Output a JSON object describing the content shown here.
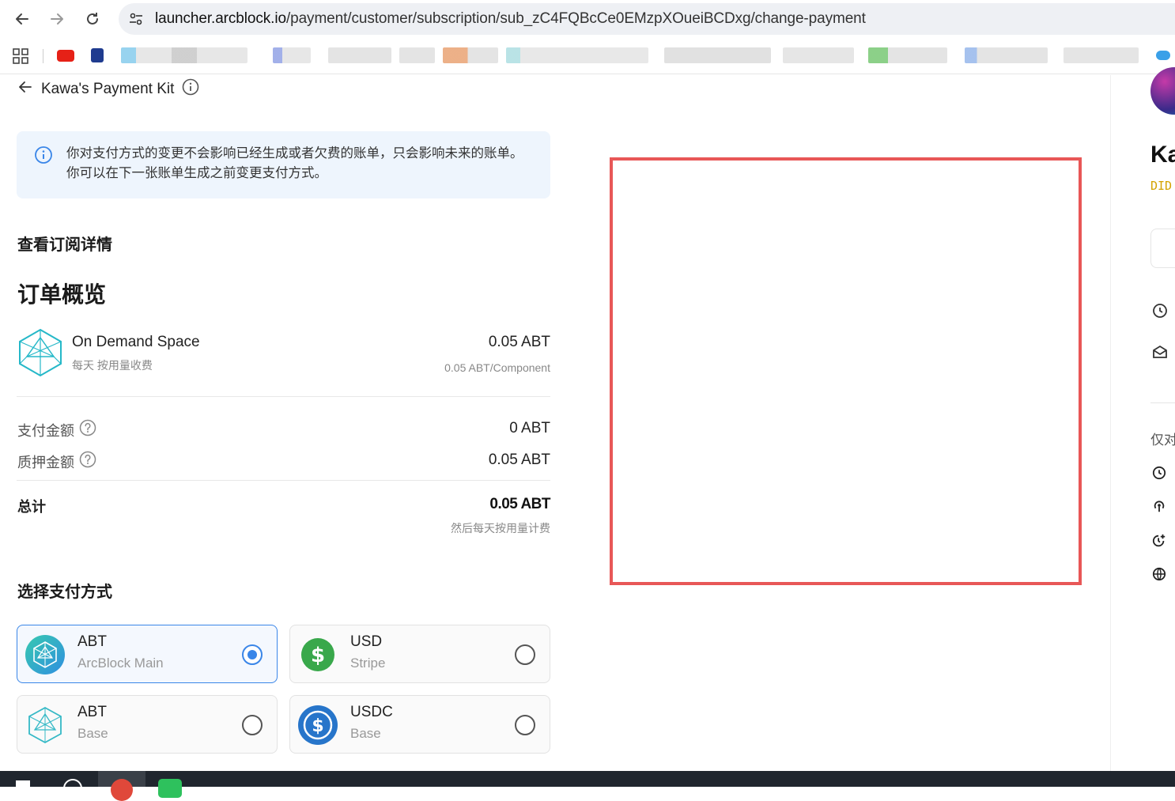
{
  "browser": {
    "url_host": "launcher.arcblock.io",
    "url_path": "/payment/customer/subscription/sub_zC4FQBcCe0EMzpXOueiBCDxg/change-payment"
  },
  "page": {
    "back_label": "Kawa's Payment Kit",
    "alert_text": "你对支付方式的变更不会影响已经生成或者欠费的账单，只会影响未来的账单。你可以在下一张账单生成之前变更支付方式。",
    "details_title": "查看订阅详情",
    "order_title": "订单概览",
    "item": {
      "name": "On Demand Space",
      "billing": "每天 按用量收费",
      "price": "0.05 ABT",
      "unit_price": "0.05 ABT/Component"
    },
    "summary": {
      "pay_label": "支付金额",
      "pay_value": "0 ABT",
      "stake_label": "质押金额",
      "stake_value": "0.05 ABT",
      "total_label": "总计",
      "total_value": "0.05 ABT",
      "total_note": "然后每天按用量计费"
    },
    "payment_title": "选择支付方式",
    "methods": [
      {
        "currency": "ABT",
        "network": "ArcBlock Main",
        "selected": true
      },
      {
        "currency": "USD",
        "network": "Stripe",
        "selected": false
      },
      {
        "currency": "ABT",
        "network": "Base",
        "selected": false
      },
      {
        "currency": "USDC",
        "network": "Base",
        "selected": false
      }
    ]
  },
  "right_pane": {
    "name_fragment": "Ka",
    "did_fragment": "DID",
    "text_fragment": "仅对"
  },
  "colors": {
    "accent": "#3a86e8",
    "alert_bg": "#eef5fd",
    "highlight_box": "#e85757",
    "did": "#d4a300"
  }
}
